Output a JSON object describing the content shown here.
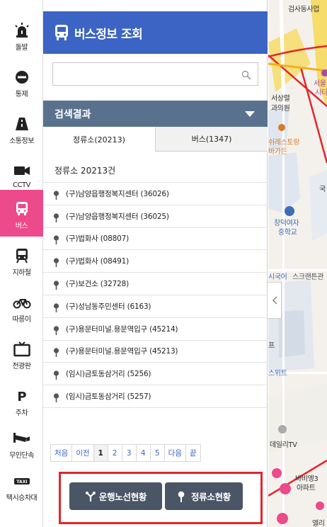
{
  "nav": [
    {
      "label": "돌발",
      "icon": "siren-icon"
    },
    {
      "label": "통제",
      "icon": "no-entry-icon"
    },
    {
      "label": "소통정보",
      "icon": "road-icon"
    },
    {
      "label": "CCTV",
      "icon": "camera-icon"
    },
    {
      "label": "버스",
      "icon": "bus-icon"
    },
    {
      "label": "지하철",
      "icon": "subway-icon"
    },
    {
      "label": "따릉이",
      "icon": "bicycle-icon"
    },
    {
      "label": "전광판",
      "icon": "signboard-icon"
    },
    {
      "label": "주차",
      "icon": "parking-icon"
    },
    {
      "label": "무인단속",
      "icon": "speed-camera-icon"
    },
    {
      "label": "택시승차대",
      "icon": "taxi-icon"
    }
  ],
  "panel": {
    "title": "버스정보 조회",
    "search": {
      "value": "",
      "placeholder": ""
    },
    "results_title": "검색결과",
    "tabs": [
      {
        "label": "정류소(20213)"
      },
      {
        "label": "버스(1347)"
      }
    ],
    "count_text": "정류소 20213건",
    "stops": [
      "(구)남양읍행정복지센터 (36026)",
      "(구)남양읍행정복지센터 (36025)",
      "(구)법화사 (08807)",
      "(구)법화사 (08491)",
      "(구)보건소 (32728)",
      "(구)성남동주민센터 (6163)",
      "(구)용문터미널.용문역입구 (45214)",
      "(구)용문터미널.용문역입구 (45213)",
      "(임시)금토동삼거리 (5256)",
      "(임시)금토동삼거리 (5257)"
    ],
    "pager": {
      "first": "처음",
      "prev": "이전",
      "pages": [
        "1",
        "2",
        "3",
        "4",
        "5"
      ],
      "current": "1",
      "next": "다음",
      "last": "끝"
    },
    "buttons": {
      "route_status": "운행노선현황",
      "stop_status": "정류소현황"
    }
  },
  "map": {
    "labels": [
      {
        "text": "서상렬",
        "color": "#333333"
      },
      {
        "text": "과의원",
        "color": "#333333"
      },
      {
        "text": "서울",
        "color": "#a64aa6"
      },
      {
        "text": "시티",
        "color": "#a64aa6"
      },
      {
        "text": "쉬레스토랑",
        "color": "#d77d2a"
      },
      {
        "text": "바가든",
        "color": "#d77d2a"
      },
      {
        "text": "국",
        "color": "#333333"
      },
      {
        "text": "창덕여자",
        "color": "#3b6fb3"
      },
      {
        "text": "중학교",
        "color": "#3b6fb3"
      },
      {
        "text": "시국어",
        "color": "#3b6fb3"
      },
      {
        "text": "스크랜튼관",
        "color": "#555555"
      },
      {
        "text": "프",
        "color": "#333333"
      },
      {
        "text": "스위트",
        "color": "#3b6fb3"
      },
      {
        "text": "데일리TV",
        "color": "#333333"
      },
      {
        "text": "바비엥3",
        "color": "#333333"
      },
      {
        "text": "아파트",
        "color": "#333333"
      },
      {
        "text": "엘리",
        "color": "#333333"
      },
      {
        "text": "검사동사업",
        "color": "#333333"
      }
    ]
  }
}
